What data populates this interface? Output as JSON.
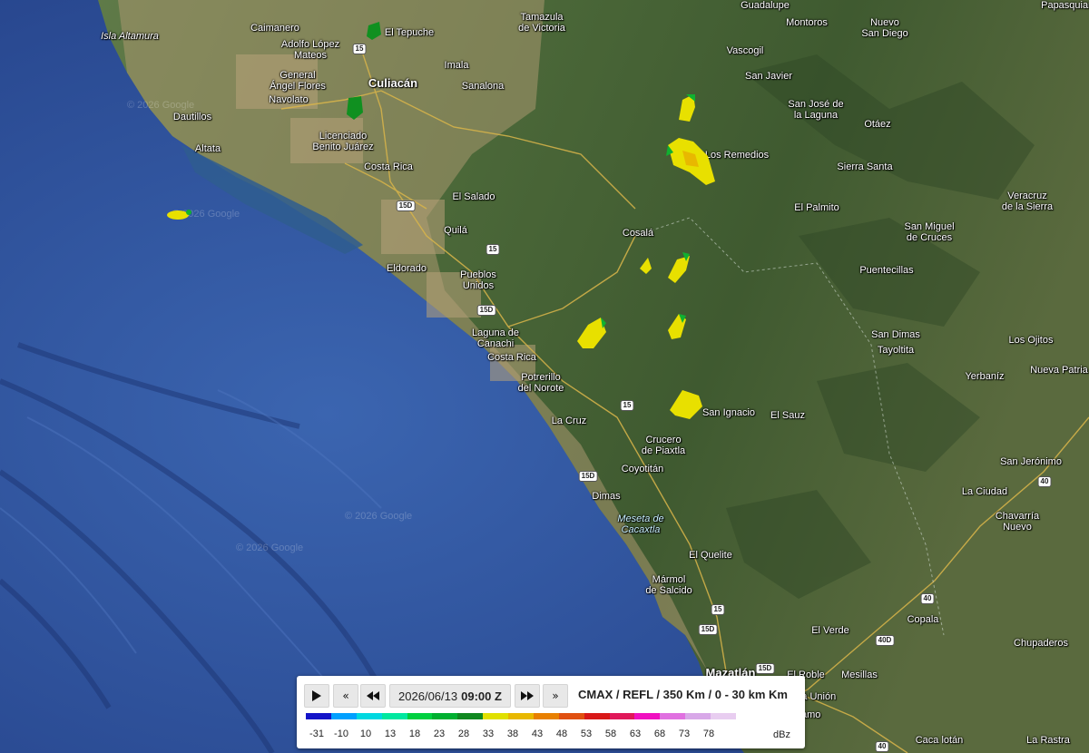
{
  "map": {
    "places": [
      {
        "name": "Isla Altamura",
        "type": "ital"
      },
      {
        "name": "Caimanero",
        "type": "town"
      },
      {
        "name": "El Tepuche",
        "type": "town"
      },
      {
        "name": "Adolfo López\nMateos",
        "type": "town"
      },
      {
        "name": "Tamazula\nde Victoria",
        "type": "town"
      },
      {
        "name": "Guadalupe",
        "type": "town"
      },
      {
        "name": "Montoros",
        "type": "town"
      },
      {
        "name": "Nuevo\nSan Diego",
        "type": "town"
      },
      {
        "name": "Papasquiaro",
        "type": "town"
      },
      {
        "name": "Vascogil",
        "type": "town"
      },
      {
        "name": "Imala",
        "type": "town"
      },
      {
        "name": "General\nÁngel Flores",
        "type": "town"
      },
      {
        "name": "Culiacán",
        "type": "city"
      },
      {
        "name": "Sanalona",
        "type": "town"
      },
      {
        "name": "San Javier",
        "type": "town"
      },
      {
        "name": "Navolato",
        "type": "town"
      },
      {
        "name": "San José de\nla Laguna",
        "type": "town"
      },
      {
        "name": "Dautillos",
        "type": "town"
      },
      {
        "name": "Otáez",
        "type": "town"
      },
      {
        "name": "Licenciado\nBenito Juárez",
        "type": "town"
      },
      {
        "name": "Altata",
        "type": "town"
      },
      {
        "name": "Los Remedios",
        "type": "town"
      },
      {
        "name": "Costa Rica",
        "type": "town"
      },
      {
        "name": "Sierra Santa",
        "type": "town"
      },
      {
        "name": "El Salado",
        "type": "town"
      },
      {
        "name": "Veracruz\nde la Sierra",
        "type": "town"
      },
      {
        "name": "El Palmito",
        "type": "town"
      },
      {
        "name": "Cosalá",
        "type": "town"
      },
      {
        "name": "Quilá",
        "type": "town"
      },
      {
        "name": "San Miguel\nde Cruces",
        "type": "town"
      },
      {
        "name": "Eldorado",
        "type": "town"
      },
      {
        "name": "Pueblos\nUnidos",
        "type": "town"
      },
      {
        "name": "Puentecillas",
        "type": "town"
      },
      {
        "name": "Laguna de\nCanachi",
        "type": "town"
      },
      {
        "name": "San Dimas",
        "type": "town"
      },
      {
        "name": "Tayoltita",
        "type": "town"
      },
      {
        "name": "Los Ojitos",
        "type": "town"
      },
      {
        "name": "Costa Rica",
        "type": "town"
      },
      {
        "name": "Nueva Patria",
        "type": "town"
      },
      {
        "name": "Yerbaníz",
        "type": "town"
      },
      {
        "name": "Potrerillo\ndel Norote",
        "type": "town"
      },
      {
        "name": "San Ignacio",
        "type": "town"
      },
      {
        "name": "El Sauz",
        "type": "town"
      },
      {
        "name": "La Cruz",
        "type": "town"
      },
      {
        "name": "Crucero\nde Piaxtla",
        "type": "town"
      },
      {
        "name": "Coyotitán",
        "type": "town"
      },
      {
        "name": "San Jerónimo",
        "type": "town"
      },
      {
        "name": "Dimas",
        "type": "town"
      },
      {
        "name": "La Ciudad",
        "type": "town"
      },
      {
        "name": "Meseta de\nCacaxtla",
        "type": "water"
      },
      {
        "name": "Chavarría\nNuevo",
        "type": "town"
      },
      {
        "name": "El Quelite",
        "type": "town"
      },
      {
        "name": "Mármol\nde Salcido",
        "type": "town"
      },
      {
        "name": "El Verde",
        "type": "town"
      },
      {
        "name": "Copala",
        "type": "town"
      },
      {
        "name": "Chupaderos",
        "type": "town"
      },
      {
        "name": "Mazatlán",
        "type": "city"
      },
      {
        "name": "El Roble",
        "type": "town"
      },
      {
        "name": "Mesillas",
        "type": "town"
      },
      {
        "name": "Villa Unión",
        "type": "town"
      },
      {
        "name": "El Walamo",
        "type": "town"
      },
      {
        "name": "Caca lotán",
        "type": "town"
      },
      {
        "name": "La Rastra",
        "type": "town"
      }
    ],
    "highway_shields": [
      "15",
      "15D",
      "15",
      "15D",
      "15",
      "15D",
      "15D",
      "15",
      "15D",
      "40",
      "40",
      "40D",
      "40"
    ],
    "watermarks": [
      "© 2026 Google",
      "© 2026 Google",
      "© 2026 Google",
      "© 2026 Google"
    ]
  },
  "player": {
    "date": "2026/06/13",
    "time": "09:00 Z",
    "product": "CMAX / REFL / 350 Km / 0 - 30 km Km",
    "buttons": {
      "play": "play-icon",
      "skip_back": "double-chevron-left-icon",
      "step_back": "rewind-icon",
      "step_forward": "fast-forward-icon",
      "skip_forward": "double-chevron-right-icon"
    }
  },
  "legend": {
    "unit": "dBz",
    "values": [
      "-31",
      "-10",
      "10",
      "13",
      "18",
      "23",
      "28",
      "33",
      "38",
      "43",
      "48",
      "53",
      "58",
      "63",
      "68",
      "73",
      "78"
    ],
    "colors": [
      "#1414c8",
      "#00a0ff",
      "#00d8e0",
      "#00e8a0",
      "#00d040",
      "#00b030",
      "#108820",
      "#e0e000",
      "#e8b800",
      "#e88000",
      "#e05010",
      "#d81818",
      "#e0185a",
      "#f010c0",
      "#e070e0",
      "#d8a8e8",
      "#e8cdf0"
    ]
  }
}
